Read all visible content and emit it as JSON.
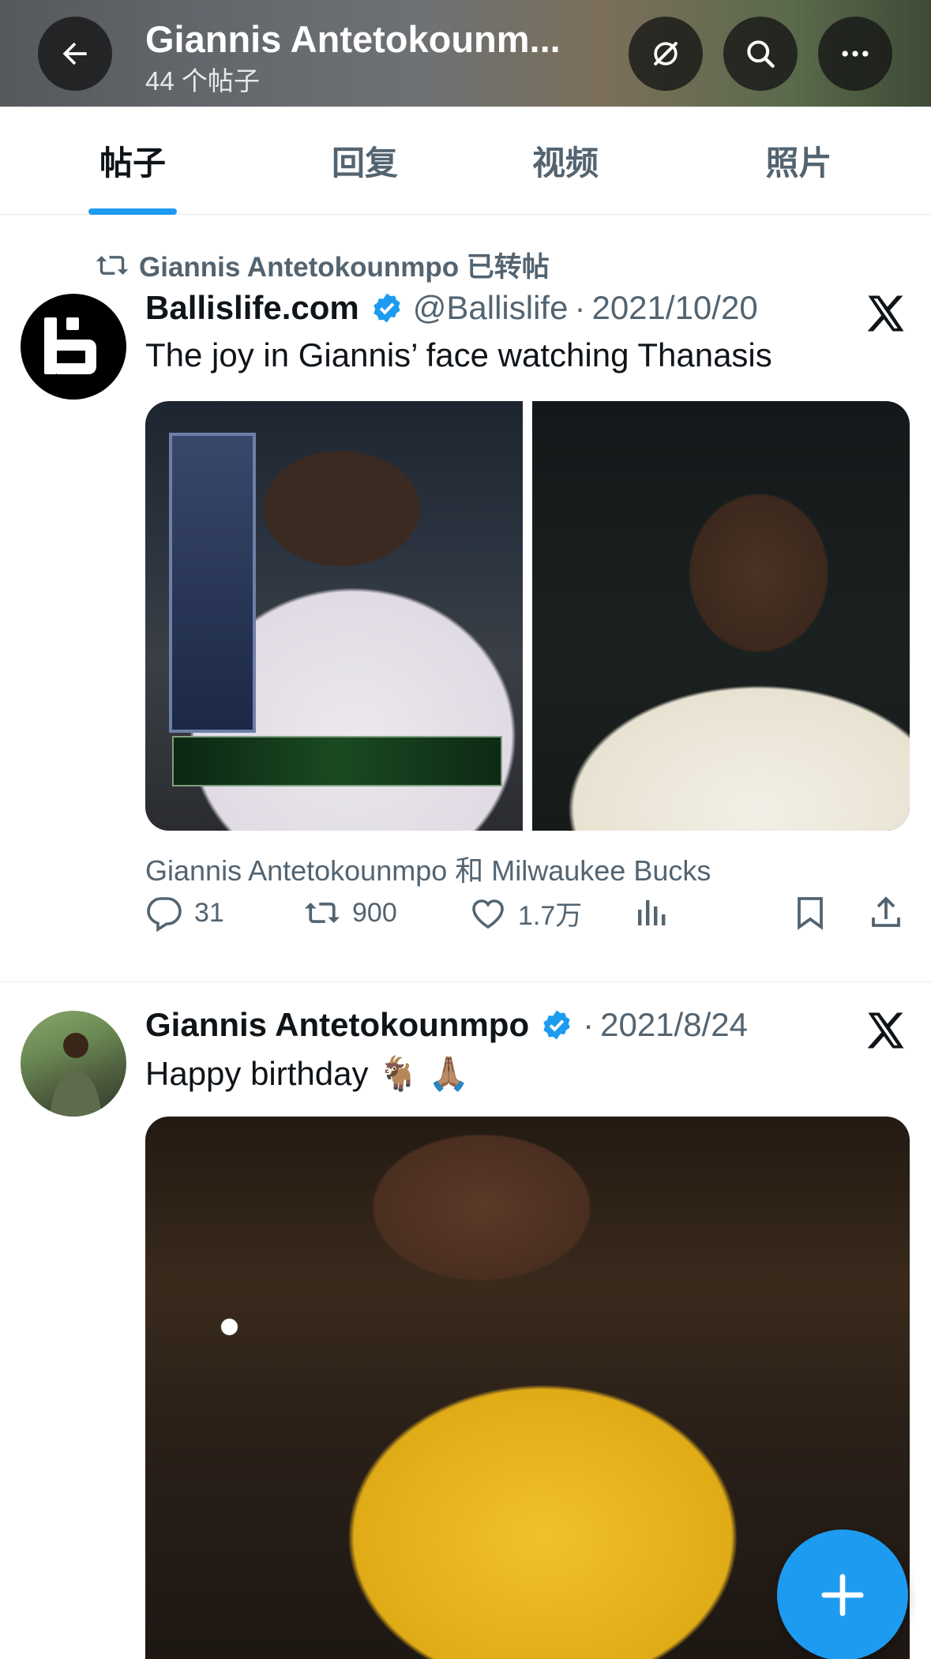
{
  "header": {
    "title": "Giannis Antetokounm...",
    "subtitle": "44 个帖子",
    "icons": [
      "back-arrow-icon",
      "grok-icon",
      "search-icon",
      "more-icon"
    ]
  },
  "tabs": [
    {
      "label": "帖子",
      "active": true
    },
    {
      "label": "回复",
      "active": false
    },
    {
      "label": "视频",
      "active": false
    },
    {
      "label": "照片",
      "active": false
    }
  ],
  "accent_color": "#1d9bf0",
  "posts": [
    {
      "repost_label": "Giannis Antetokounmpo 已转帖",
      "author": "Ballislife.com",
      "verified": true,
      "handle": "@Ballislife",
      "separator": "·",
      "date": "2021/10/20",
      "text": "The joy in Giannis’ face watching Thanasis",
      "tagged": "Giannis Antetokounmpo 和 Milwaukee Bucks",
      "stats": {
        "replies": "31",
        "reposts": "900",
        "likes": "1.7万"
      }
    },
    {
      "author": "Giannis Antetokounmpo",
      "verified": true,
      "separator": "·",
      "date": "2021/8/24",
      "text": "Happy birthday 🐐 🙏🏽"
    }
  ]
}
